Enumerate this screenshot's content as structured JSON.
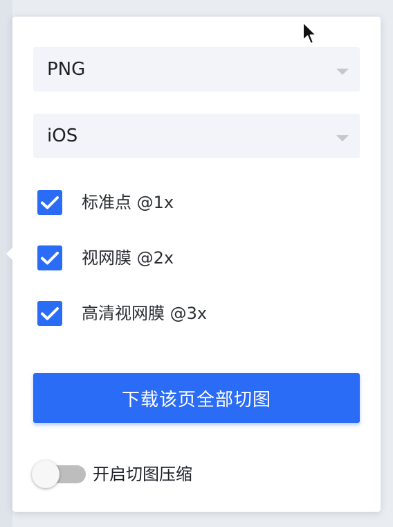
{
  "format_select": {
    "value": "PNG"
  },
  "platform_select": {
    "value": "iOS"
  },
  "scale_options": [
    {
      "label": "标准点 @1x",
      "checked": true
    },
    {
      "label": "视网膜 @2x",
      "checked": true
    },
    {
      "label": "高清视网膜 @3x",
      "checked": true
    }
  ],
  "download_button": {
    "label": "下载该页全部切图"
  },
  "compress_toggle": {
    "label": "开启切图压缩",
    "on": false
  },
  "colors": {
    "accent": "#2b6cf6",
    "select_bg": "#f2f4f9",
    "toggle_off": "#bdbdbd"
  },
  "icons": {
    "checkbox": "check-icon",
    "select": "caret-down-icon",
    "pointer": "mouse-cursor-icon"
  }
}
